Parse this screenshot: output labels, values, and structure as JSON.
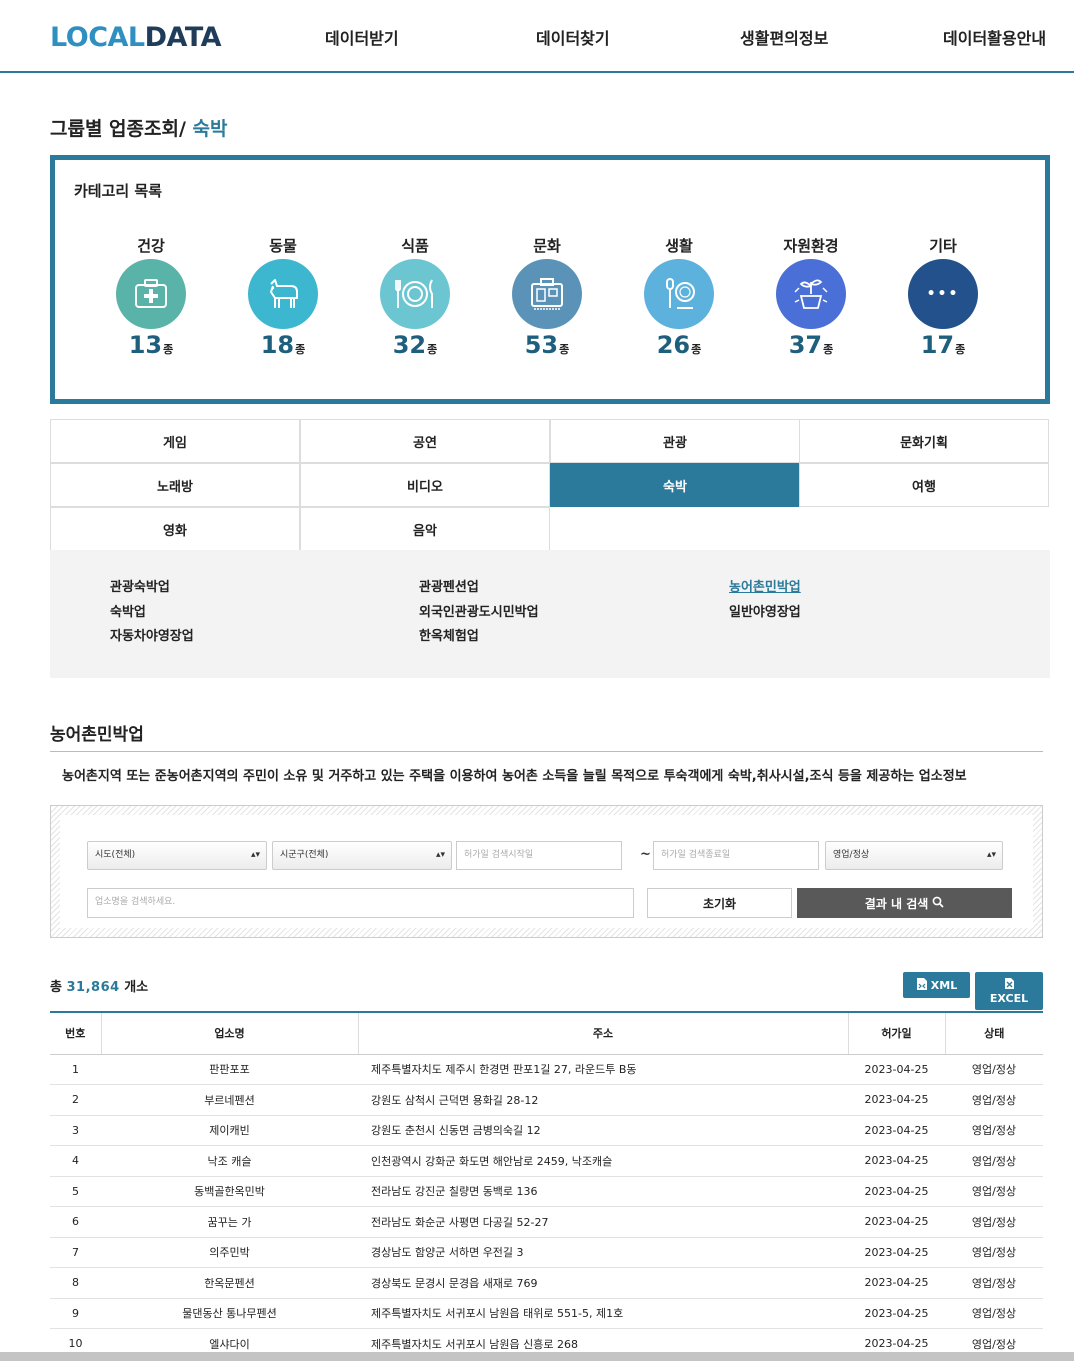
{
  "header": {
    "logo_part1": "LOCAL",
    "logo_part2": "DATA",
    "nav": [
      "데이터받기",
      "데이터찾기",
      "생활편의정보",
      "데이터활용안내"
    ]
  },
  "page_title": {
    "main": "그룹별 업종조회/",
    "sub": "숙박"
  },
  "category_box": {
    "title": "카테고리 목록",
    "unit": "종",
    "categories": [
      {
        "name": "건강",
        "count": "13",
        "color": "#5ab3a8",
        "icon": "medical-kit-icon"
      },
      {
        "name": "동물",
        "count": "18",
        "color": "#3db6cf",
        "icon": "goat-icon"
      },
      {
        "name": "식품",
        "count": "32",
        "color": "#6cc6d2",
        "icon": "plate-cutlery-icon"
      },
      {
        "name": "문화",
        "count": "53",
        "color": "#5b93b8",
        "icon": "suitcase-icon"
      },
      {
        "name": "생활",
        "count": "26",
        "color": "#5cb2dc",
        "icon": "mirror-brush-icon"
      },
      {
        "name": "자원환경",
        "count": "37",
        "color": "#4a6fd6",
        "icon": "plant-recycle-icon"
      },
      {
        "name": "기타",
        "count": "17",
        "color": "#22518c",
        "icon": "more-icon",
        "glyph": "•••"
      }
    ]
  },
  "subcategories": [
    [
      "게임",
      "공연",
      "관광",
      "문화기획"
    ],
    [
      "노래방",
      "비디오",
      "숙박",
      "여행"
    ],
    [
      "영화",
      "음악"
    ]
  ],
  "active_subcategory": "숙박",
  "business_types": [
    {
      "label": "관광숙박업",
      "active": false
    },
    {
      "label": "관광펜션업",
      "active": false
    },
    {
      "label": "농어촌민박업",
      "active": true
    },
    {
      "label": "숙박업",
      "active": false
    },
    {
      "label": "외국인관광도시민박업",
      "active": false
    },
    {
      "label": "일반야영장업",
      "active": false
    },
    {
      "label": "자동차야영장업",
      "active": false
    },
    {
      "label": "한옥체험업",
      "active": false
    }
  ],
  "section": {
    "title": "농어촌민박업",
    "description": "농어촌지역 또는 준농어촌지역의 주민이 소유 및 거주하고 있는 주택을 이용하여 농어촌 소득을 늘릴 목적으로 투숙객에게 숙박,취사시설,조식 등을 제공하는 업소정보"
  },
  "search": {
    "sido": "시도(전체)",
    "sigungu": "시군구(전체)",
    "date_start_placeholder": "허가일 검색시작일",
    "tilde": "~",
    "date_end_placeholder": "허가일 검색종료일",
    "status": "영업/정상",
    "name_placeholder": "업소명을 검색하세요.",
    "reset_label": "초기화",
    "search_label": "결과 내 검색"
  },
  "results": {
    "total_prefix": "총",
    "total_count": "31,864",
    "total_suffix": "개소",
    "xml_label": "XML",
    "excel_label": "EXCEL",
    "columns": [
      "번호",
      "업소명",
      "주소",
      "허가일",
      "상태"
    ],
    "rows": [
      [
        "1",
        "판판포포",
        "제주특별자치도 제주시 한경면 판포1길 27, 라운드투 B동",
        "2023-04-25",
        "영업/정상"
      ],
      [
        "2",
        "부르네펜션",
        "강원도 삼척시 근덕면 용화길 28-12",
        "2023-04-25",
        "영업/정상"
      ],
      [
        "3",
        "제이캐빈",
        "강원도 춘천시 신동면 금병의숙길 12",
        "2023-04-25",
        "영업/정상"
      ],
      [
        "4",
        "낙조 캐슬",
        "인천광역시 강화군 화도면 해안남로 2459, 낙조캐슬",
        "2023-04-25",
        "영업/정상"
      ],
      [
        "5",
        "동백골한옥민박",
        "전라남도 강진군 칠량면 동백로 136",
        "2023-04-25",
        "영업/정상"
      ],
      [
        "6",
        "꿈꾸는 가",
        "전라남도 화순군 사평면 다공길 52-27",
        "2023-04-25",
        "영업/정상"
      ],
      [
        "7",
        "의주민박",
        "경상남도 함양군 서하면 우전길 3",
        "2023-04-25",
        "영업/정상"
      ],
      [
        "8",
        "한옥문펜션",
        "경상북도 문경시 문경읍 새재로 769",
        "2023-04-25",
        "영업/정상"
      ],
      [
        "9",
        "물댄동산 통나무펜션",
        "제주특별자치도 서귀포시 남원읍 태위로 551-5, 제1호",
        "2023-04-25",
        "영업/정상"
      ],
      [
        "10",
        "엘샤다이",
        "제주특별자치도 서귀포시 남원읍 신흥로 268",
        "2023-04-25",
        "영업/정상"
      ]
    ]
  },
  "colors": {
    "accent": "#2b7a9b",
    "accent_dark": "#1e5f7e",
    "search_button": "#595959"
  }
}
